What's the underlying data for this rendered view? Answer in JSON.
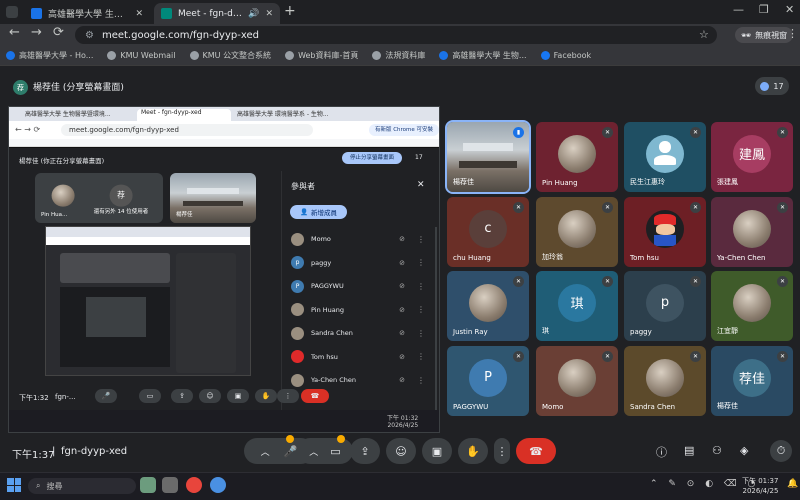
{
  "tabs": [
    {
      "label": "高雄醫學大學 生物醫學暨環境生物學系",
      "active": false,
      "color": "#1a73e8"
    },
    {
      "label": "Meet - fgn-dyyp-xed",
      "active": true,
      "color": "#00897b"
    }
  ],
  "address": "meet.google.com/fgn-dyyp-xed",
  "incognito_label": "無痕視窗",
  "bookmarks": [
    {
      "label": "高雄醫學大學 - Ho...",
      "color": "#1a73e8"
    },
    {
      "label": "KMU Webmail",
      "color": "#9aa0a6"
    },
    {
      "label": "KMU 公文整合系統",
      "color": "#9aa0a6"
    },
    {
      "label": "Web資料庫-首頁",
      "color": "#9aa0a6"
    },
    {
      "label": "法規資料庫",
      "color": "#9aa0a6"
    },
    {
      "label": "高雄醫學大學 生物...",
      "color": "#1a73e8"
    },
    {
      "label": "Facebook",
      "color": "#1877f2"
    }
  ],
  "meeting": {
    "presenter_initial": "荐",
    "presenter_title": "楊荐佳 (分享螢幕畫面)",
    "participant_count": "17",
    "time": "下午1:37",
    "code": "fgn-dyyp-xed"
  },
  "shared": {
    "tabs": [
      "高雄醫學大學 生物醫學暨環境...",
      "Meet - fgn-dyyp-xed",
      "高雄醫學大學 環境醫學系 - 生物..."
    ],
    "address": "meet.google.com/fgn-dyyp-xed",
    "chrome_label": "有新版 Chrome 可安裝",
    "presenter_title": "楊荐佳 (你正在分享螢幕畫面)",
    "stop_label": "停止分享螢幕畫面",
    "count": "17",
    "mini_tiles": [
      {
        "name": "Pin Hua...",
        "kind": "photo"
      },
      {
        "name": "還有另外 14 位使用者",
        "kind": "initial",
        "initial": "荐"
      },
      {
        "name": "楊荐佳",
        "kind": "room"
      }
    ],
    "panel": {
      "title": "參與者",
      "add_label": "新增成員",
      "people": [
        {
          "name": "Momo",
          "kind": "photo"
        },
        {
          "name": "paggy",
          "kind": "initial",
          "initial": "p"
        },
        {
          "name": "PAGGYWU",
          "kind": "initial",
          "initial": "P"
        },
        {
          "name": "Pin Huang",
          "kind": "photo"
        },
        {
          "name": "Sandra Chen",
          "kind": "photo"
        },
        {
          "name": "Tom hsu",
          "kind": "mario"
        },
        {
          "name": "Ya-Chen Chen",
          "kind": "photo"
        }
      ]
    },
    "time": "下午1:32",
    "code": "fgn-...",
    "clock_time": "下午 01:32",
    "clock_date": "2026/4/25"
  },
  "grid": [
    {
      "name": "楊荐佳",
      "kind": "room",
      "bg": "#6b7a8a",
      "speaking": true
    },
    {
      "name": "Pin Huang",
      "kind": "photo",
      "bg": "#6e2230"
    },
    {
      "name": "民生江惠玲",
      "kind": "icon",
      "bg": "#1f4f63",
      "color": "#7fb8d0"
    },
    {
      "name": "張建鳳",
      "kind": "initial",
      "initial": "建鳳",
      "bg": "#7a2540",
      "color": "#a73d62"
    },
    {
      "name": "chu Huang",
      "kind": "initial",
      "initial": "c",
      "bg": "#6a2f27",
      "color": "#5a3f3a"
    },
    {
      "name": "加玲翁",
      "kind": "photo",
      "bg": "#5e4a2e"
    },
    {
      "name": "Tom hsu",
      "kind": "mario",
      "bg": "#6d1f25"
    },
    {
      "name": "Ya-Chen Chen",
      "kind": "photo",
      "bg": "#5a2a3e"
    },
    {
      "name": "Justin Ray",
      "kind": "photo",
      "bg": "#2f4f6b"
    },
    {
      "name": "琪",
      "kind": "initial",
      "initial": "琪",
      "bg": "#1f5d76",
      "color": "#2a78a0"
    },
    {
      "name": "paggy",
      "kind": "initial",
      "initial": "p",
      "bg": "#2c3f4c",
      "color": "#3e5361"
    },
    {
      "name": "江宜靜",
      "kind": "photo",
      "bg": "#3f5b2a"
    },
    {
      "name": "PAGGYWU",
      "kind": "initial",
      "initial": "P",
      "bg": "#2f5670",
      "color": "#3f7bb0"
    },
    {
      "name": "Momo",
      "kind": "photo",
      "bg": "#6a3f35"
    },
    {
      "name": "Sandra Chen",
      "kind": "photo",
      "bg": "#5c4a2b"
    },
    {
      "name": "楊荐佳",
      "kind": "initial",
      "initial": "荐佳",
      "bg": "#2a4a63",
      "color": "#3d6f88"
    }
  ],
  "taskbar": {
    "search": "搜尋",
    "time": "下午 01:37",
    "date": "2026/4/25"
  }
}
